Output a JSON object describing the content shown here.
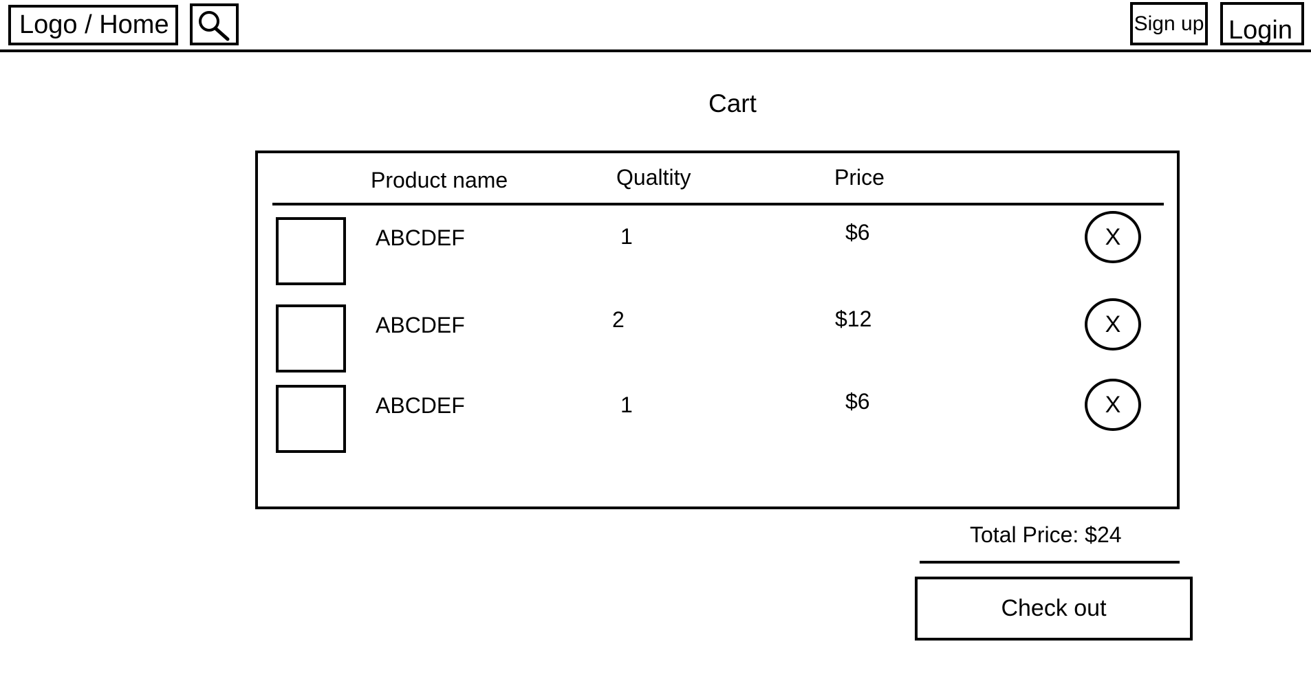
{
  "header": {
    "logo_label": "Logo / Home",
    "search_icon": "search-icon",
    "signup_label": "Sign up",
    "login_label": "Login"
  },
  "page": {
    "title": "Cart"
  },
  "table": {
    "columns": {
      "product": "Product name",
      "quantity": "Qualtity",
      "price": "Price"
    },
    "rows": [
      {
        "name": "ABCDEF",
        "quantity": "1",
        "price": "$6",
        "remove_label": "X"
      },
      {
        "name": "ABCDEF",
        "quantity": "2",
        "price": "$12",
        "remove_label": "X"
      },
      {
        "name": "ABCDEF",
        "quantity": "1",
        "price": "$6",
        "remove_label": "X"
      }
    ]
  },
  "summary": {
    "total_label": "Total Price: $24",
    "checkout_label": "Check out"
  }
}
